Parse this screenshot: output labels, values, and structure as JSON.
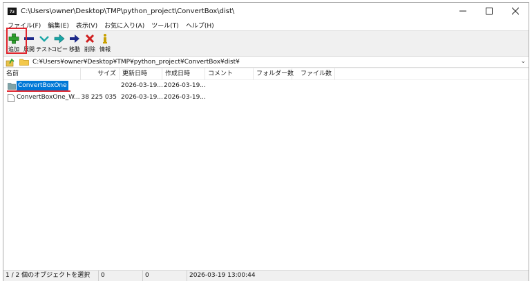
{
  "window": {
    "title": "C:\\Users\\owner\\Desktop\\TMP\\python_project\\ConvertBox\\dist\\",
    "app_icon_text": "7z",
    "controls": {
      "minimize": "—",
      "maximize": "☐",
      "close": "✕"
    }
  },
  "menu": [
    {
      "label": "ファイル(F)"
    },
    {
      "label": "編集(E)"
    },
    {
      "label": "表示(V)"
    },
    {
      "label": "お気に入り(A)"
    },
    {
      "label": "ツール(T)"
    },
    {
      "label": "ヘルプ(H)"
    }
  ],
  "toolbar": [
    {
      "label": "追加",
      "icon": "add-icon"
    },
    {
      "label": "展開",
      "icon": "extract-icon"
    },
    {
      "label": "テスト",
      "icon": "test-icon"
    },
    {
      "label": "コピー",
      "icon": "copy-icon"
    },
    {
      "label": "移動",
      "icon": "move-icon"
    },
    {
      "label": "削除",
      "icon": "delete-icon"
    },
    {
      "label": "情報",
      "icon": "info-icon"
    }
  ],
  "address": {
    "path": "C:¥Users¥owner¥Desktop¥TMP¥python_project¥ConvertBox¥dist¥",
    "dropdown": "⌄"
  },
  "columns": [
    "名前",
    "サイズ",
    "更新日時",
    "作成日時",
    "コメント",
    "フォルダー数",
    "ファイル数"
  ],
  "rows": [
    {
      "name": "ConvertBoxOne",
      "type": "folder",
      "size": "",
      "modified": "2026-03-19...",
      "created": "2026-03-19...",
      "comment": "",
      "folders": "",
      "files": "",
      "selected": true
    },
    {
      "name": "ConvertBoxOne_W...",
      "type": "file",
      "size": "38 225 035",
      "modified": "2026-03-19...",
      "created": "2026-03-19...",
      "comment": "",
      "folders": "",
      "files": "",
      "selected": false
    }
  ],
  "status": {
    "selection": "1 / 2 個のオブジェクトを選択",
    "size": "0",
    "packed": "0",
    "datetime": "2026-03-19 13:00:44"
  },
  "colors": {
    "selection": "#0078d7",
    "highlight_red": "#e0242c",
    "add_green": "#2fa12f",
    "delete_red": "#d02020",
    "arrow_navy": "#1d2a8a",
    "teal": "#1aa6a6",
    "folder": "#7fa3a8"
  }
}
